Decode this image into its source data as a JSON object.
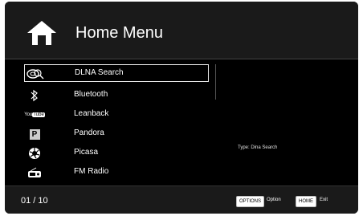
{
  "header": {
    "title": "Home Menu"
  },
  "menu": {
    "items": [
      {
        "label": "DLNA Search",
        "icon": "dlna-search-icon"
      },
      {
        "label": "Bluetooth",
        "icon": "bluetooth-icon"
      },
      {
        "label": "Leanback",
        "icon": "youtube-icon",
        "icon_text": "You Tube"
      },
      {
        "label": "Pandora",
        "icon": "pandora-icon",
        "icon_text": "P"
      },
      {
        "label": "Picasa",
        "icon": "picasa-icon"
      },
      {
        "label": "FM Radio",
        "icon": "radio-icon"
      }
    ],
    "selected_index": 0
  },
  "info": {
    "type_text": "Type: Dina Search"
  },
  "footer": {
    "page_indicator": "01 / 10",
    "options_key": "OPTIONS",
    "options_label": "Option",
    "home_key": "HOME",
    "home_label": "Exit"
  },
  "colors": {
    "background": "#000000",
    "header": "#1a1a1a",
    "text": "#ffffff",
    "selection_border": "#e6e6e6"
  }
}
